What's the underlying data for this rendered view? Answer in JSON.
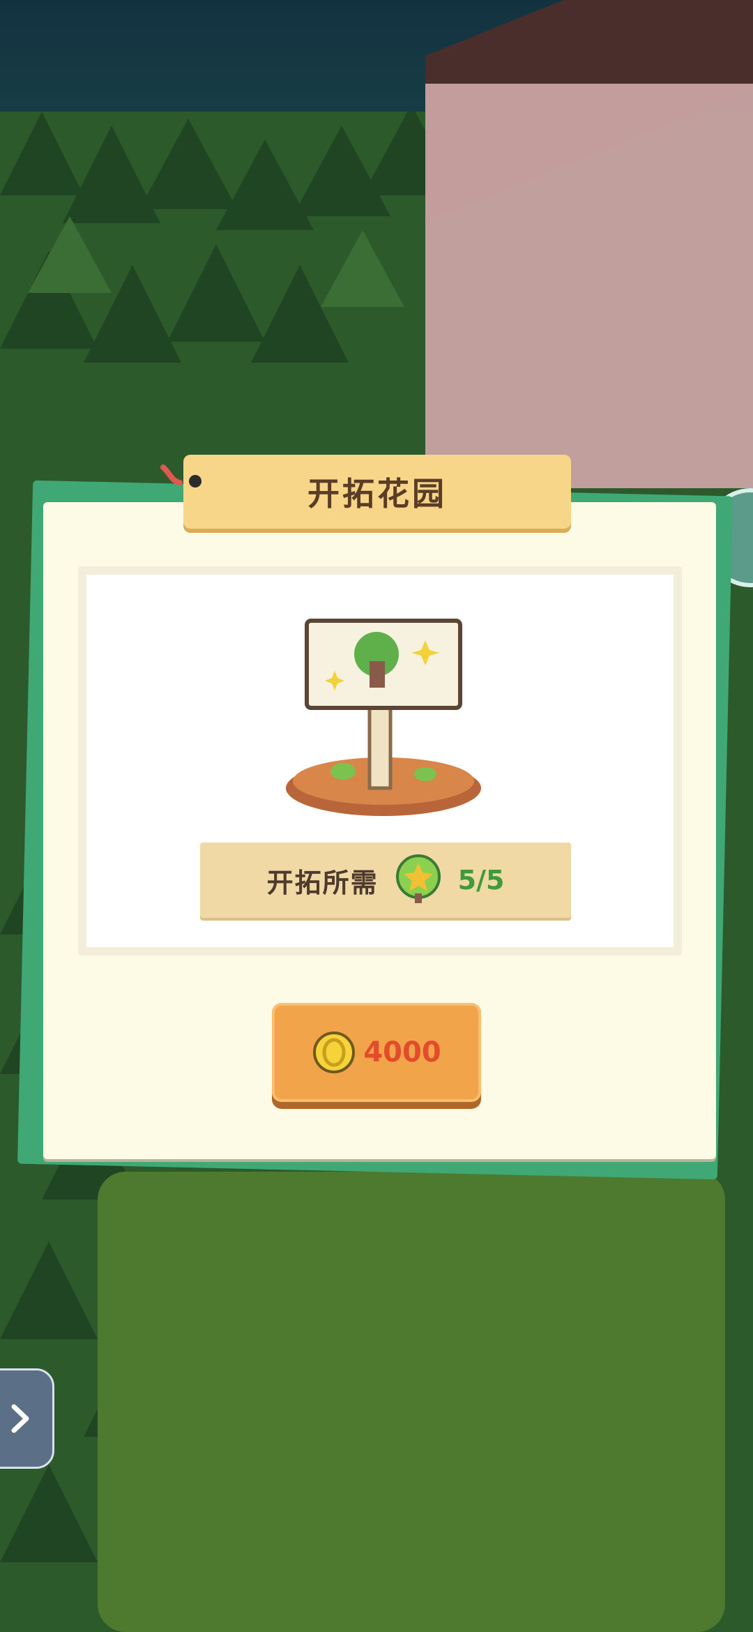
{
  "dialog": {
    "title": "开拓花园",
    "requirement_label": "开拓所需",
    "requirement_count": "5/5",
    "price": "4000"
  },
  "icons": {
    "pin": "pin-icon",
    "sign": "garden-sign-icon",
    "tree": "tree-icon",
    "coin": "coin-icon",
    "side_arrow": "chevron-right-icon",
    "chat": "chat-bubble-icon"
  },
  "colors": {
    "panel": "#fdfae6",
    "panel_back": "#3fa874",
    "ribbon": "#f7d68a",
    "button": "#f1a449",
    "price_text": "#e24b2b",
    "count_text": "#3f9a3e"
  }
}
